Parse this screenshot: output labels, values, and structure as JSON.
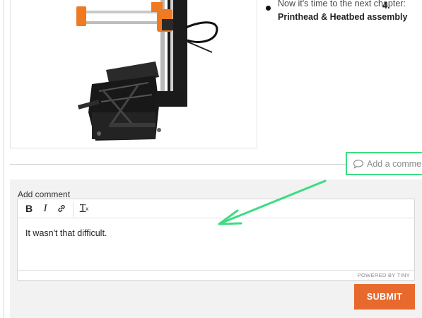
{
  "instructions": {
    "step_text_cut": "Now it's time to the next chapter:",
    "chapter_number": "4.",
    "chapter_name": "Printhead & Heatbed assembly"
  },
  "comment_link": {
    "label": "Add a comment",
    "icon": "speech-bubble-icon"
  },
  "comment_form": {
    "label": "Add comment",
    "toolbar": {
      "bold": "B",
      "italic": "I",
      "link_icon": "link-icon",
      "clear_format": "T",
      "clear_format_sub": "x"
    },
    "body_text": "It wasn't that difficult.",
    "powered_by": "POWERED BY TINY",
    "submit_label": "SUBMIT"
  },
  "colors": {
    "accent_orange": "#e8692d",
    "highlight_green": "#3ddc84",
    "panel_bg": "#f2f2f2"
  }
}
